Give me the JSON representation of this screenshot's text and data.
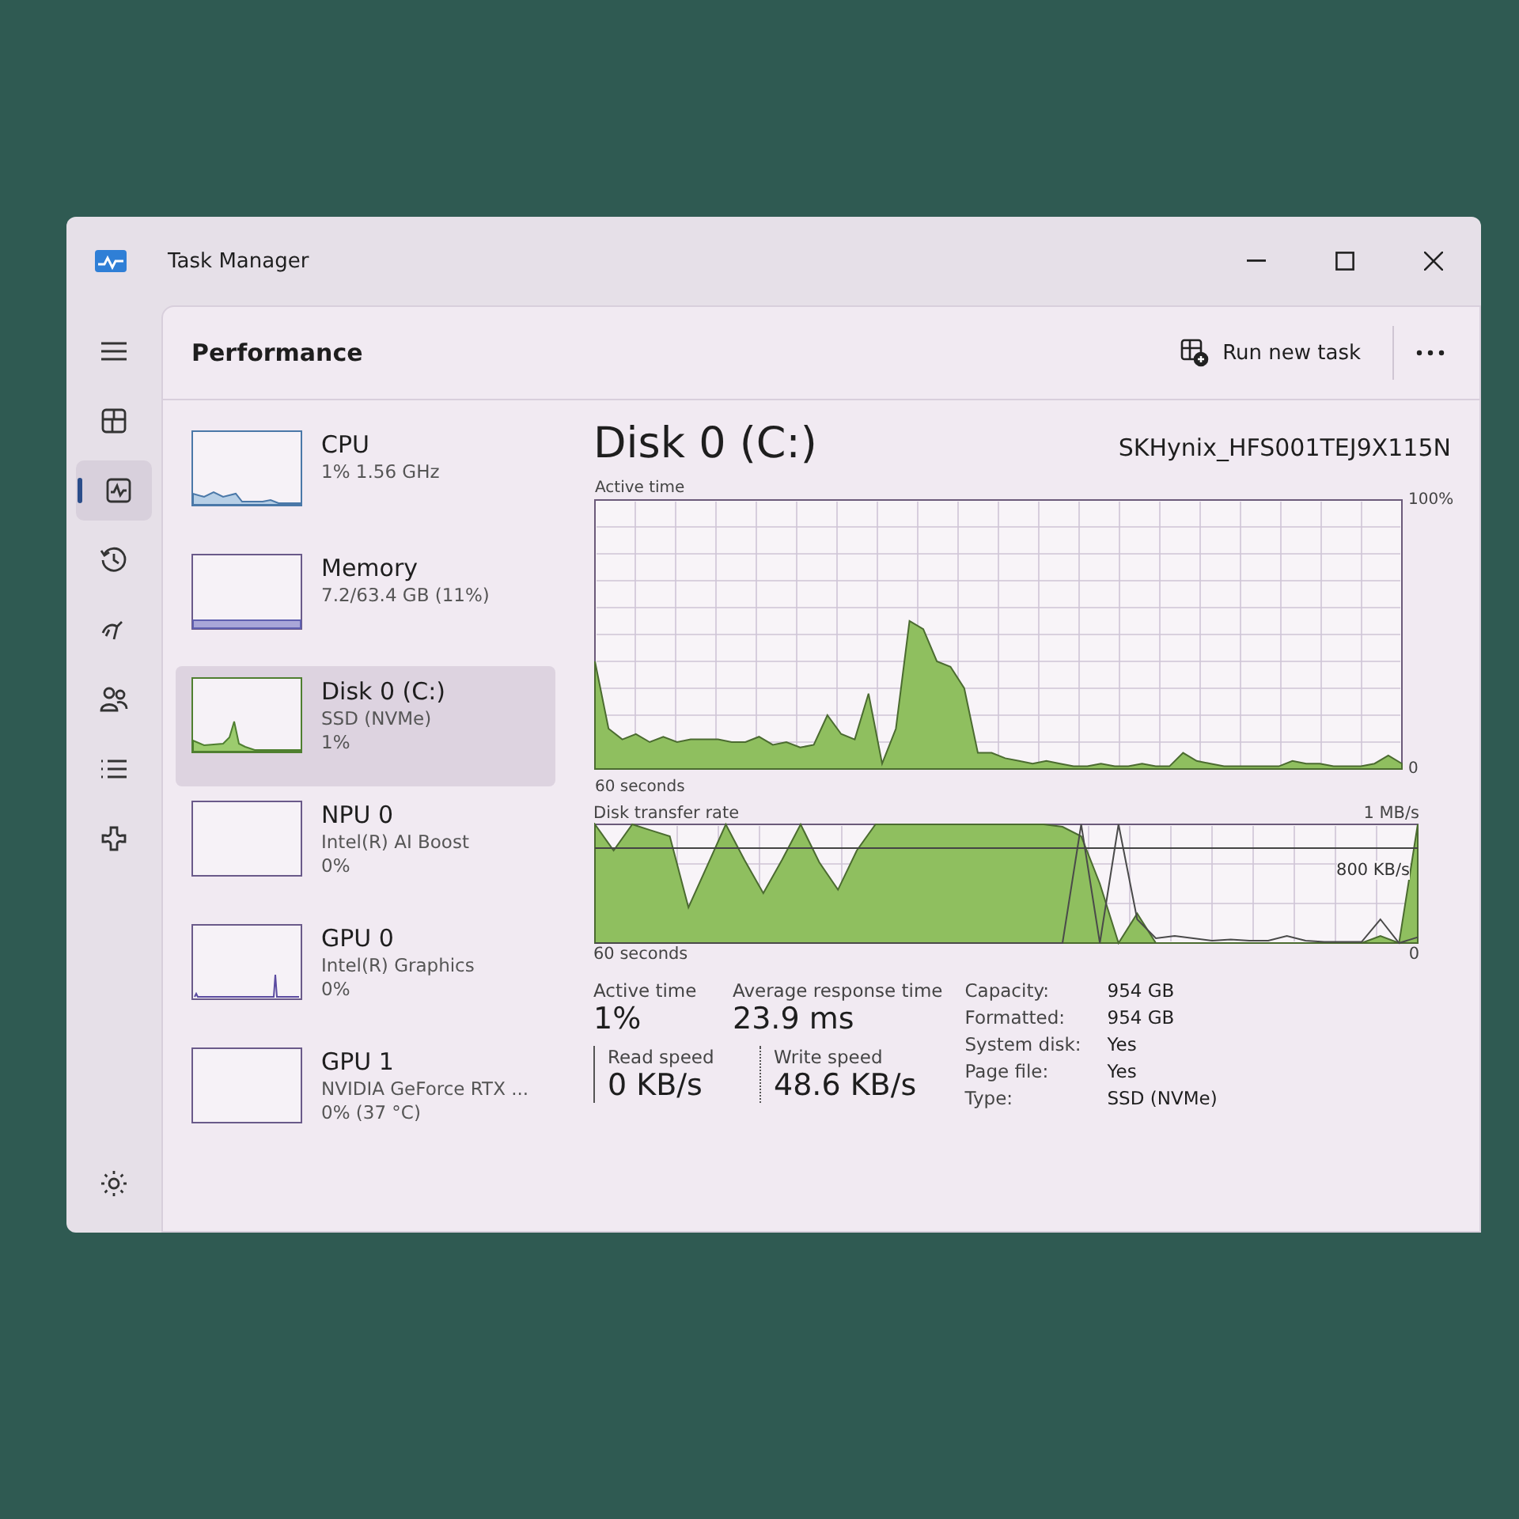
{
  "window": {
    "title": "Task Manager"
  },
  "nav": [
    {
      "kind": "menu",
      "selected": false
    },
    {
      "kind": "processes",
      "selected": false
    },
    {
      "kind": "performance",
      "selected": true
    },
    {
      "kind": "history",
      "selected": false
    },
    {
      "kind": "startup",
      "selected": false
    },
    {
      "kind": "users",
      "selected": false
    },
    {
      "kind": "details",
      "selected": false
    },
    {
      "kind": "services",
      "selected": false
    },
    {
      "kind": "settings",
      "selected": false
    }
  ],
  "page": {
    "title": "Performance",
    "run_task": "Run new task"
  },
  "devices": [
    {
      "name": "CPU",
      "lines": [
        "1%  1.56 GHz"
      ],
      "kind": "cpu",
      "selected": false
    },
    {
      "name": "Memory",
      "lines": [
        "7.2/63.4 GB (11%)"
      ],
      "kind": "memory",
      "selected": false
    },
    {
      "name": "Disk 0 (C:)",
      "lines": [
        "SSD (NVMe)",
        "1%"
      ],
      "kind": "disk",
      "selected": true
    },
    {
      "name": "NPU 0",
      "lines": [
        "Intel(R) AI Boost",
        "0%"
      ],
      "kind": "idle",
      "selected": false
    },
    {
      "name": "GPU 0",
      "lines": [
        "Intel(R) Graphics",
        "0%"
      ],
      "kind": "spike",
      "selected": false
    },
    {
      "name": "GPU 1",
      "lines": [
        "NVIDIA GeForce RTX ...",
        "0% (37 °C)"
      ],
      "kind": "idle",
      "selected": false
    }
  ],
  "detail": {
    "title": "Disk 0 (C:)",
    "model": "SKHynix_HFS001TEJ9X115N",
    "active_time": {
      "chart_data": {
        "type": "area",
        "title": "Active time",
        "xlabel": "60 seconds",
        "grid": true,
        "ylim": [
          0,
          100
        ],
        "yticks": [
          {
            "value": 0,
            "label": "0"
          },
          {
            "value": 100,
            "label": "100%"
          }
        ],
        "series": [
          {
            "color": "#8fbf5f",
            "values": [
              40,
              15,
              11,
              13,
              10,
              12,
              10,
              11,
              11,
              11,
              10,
              10,
              12,
              9,
              10,
              8,
              9,
              20,
              13,
              11,
              28,
              2,
              15,
              55,
              52,
              40,
              38,
              30,
              6,
              6,
              4,
              3,
              2,
              3,
              2,
              1,
              1,
              2,
              1,
              1,
              2,
              1,
              1,
              6,
              3,
              2,
              1,
              1,
              1,
              1,
              1,
              3,
              2,
              2,
              1,
              1,
              1,
              2,
              5,
              2
            ]
          }
        ]
      }
    },
    "transfer_rate": {
      "title": "Disk transfer rate",
      "max_label": "1 MB/s",
      "mid_label": "800 KB/s",
      "time_label": "60 seconds",
      "min_label": "0"
    },
    "stats": [
      {
        "label": "Active time",
        "value": "1%"
      },
      {
        "label": "Average response time",
        "value": "23.9 ms"
      }
    ],
    "speeds": [
      {
        "label": "Read speed",
        "value": "0 KB/s",
        "kind": "solid"
      },
      {
        "label": "Write speed",
        "value": "48.6 KB/s",
        "kind": "dotted"
      }
    ],
    "properties": [
      {
        "label": "Capacity:",
        "value": "954 GB"
      },
      {
        "label": "Formatted:",
        "value": "954 GB"
      },
      {
        "label": "System disk:",
        "value": "Yes"
      },
      {
        "label": "Page file:",
        "value": "Yes"
      },
      {
        "label": "Type:",
        "value": "SSD (NVMe)"
      }
    ]
  }
}
